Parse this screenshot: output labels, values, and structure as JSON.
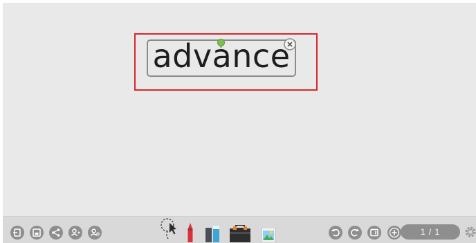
{
  "canvas": {
    "text_object": {
      "text": "advance"
    }
  },
  "toolbar": {
    "left_buttons": [
      "exit-icon",
      "save-icon",
      "share-icon",
      "user-add-icon",
      "user-settings-icon"
    ],
    "tools": [
      "lasso-select-icon",
      "pen-icon",
      "eraser-icon",
      "toolbox-icon",
      "image-icon"
    ],
    "right_buttons": [
      "undo-icon",
      "redo-icon",
      "screen-icon",
      "add-page-icon",
      "settings-icon"
    ],
    "page_indicator": "1 / 1"
  },
  "colors": {
    "canvas_bg": "#e9e9e9",
    "toolbar_bg": "#d9d9d9",
    "icon_circle": "#8e8e8e",
    "selection_red": "#d4282e",
    "rotate_handle": "#6aad46"
  }
}
